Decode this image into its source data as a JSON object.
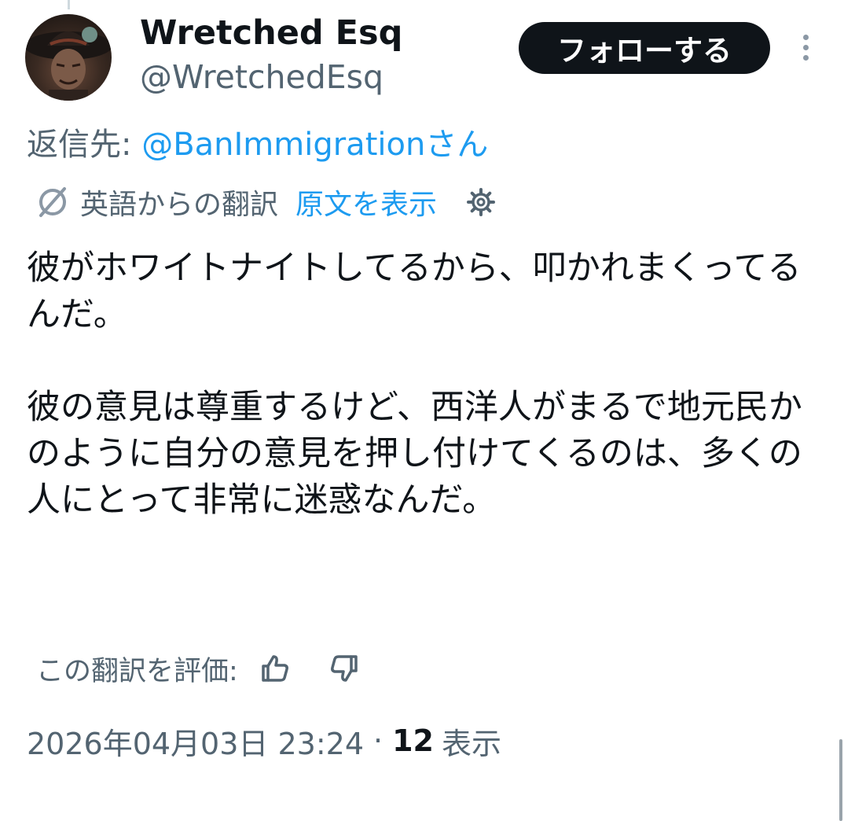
{
  "author": {
    "display_name": "Wretched Esq",
    "handle": "@WretchedEsq"
  },
  "follow_button_label": "フォローする",
  "reply": {
    "prefix": "返信先: ",
    "mention": "@BanImmigrationさん"
  },
  "translation": {
    "label": "英語からの翻訳",
    "show_original": "原文を表示"
  },
  "tweet_text": "彼がホワイトナイトしてるから、叩かれまくってるんだ。\n\n彼の意見は尊重するけど、西洋人がまるで地元民かのように自分の意見を押し付けてくるのは、多くの人にとって非常に迷惑なんだ。",
  "rating": {
    "label": "この翻訳を評価:"
  },
  "meta": {
    "timestamp": "2026年04月03日 23:24",
    "separator": "·",
    "views_count": "12",
    "views_label": "表示"
  },
  "icons": {
    "translate": "translate-icon",
    "settings": "gear-icon",
    "thumbs_up": "thumbs-up-icon",
    "thumbs_down": "thumbs-down-icon",
    "more": "more-vertical-icon"
  },
  "colors": {
    "text": "#0f1419",
    "secondary": "#536471",
    "link": "#1d9bf0",
    "follow_bg": "#0f1419"
  }
}
